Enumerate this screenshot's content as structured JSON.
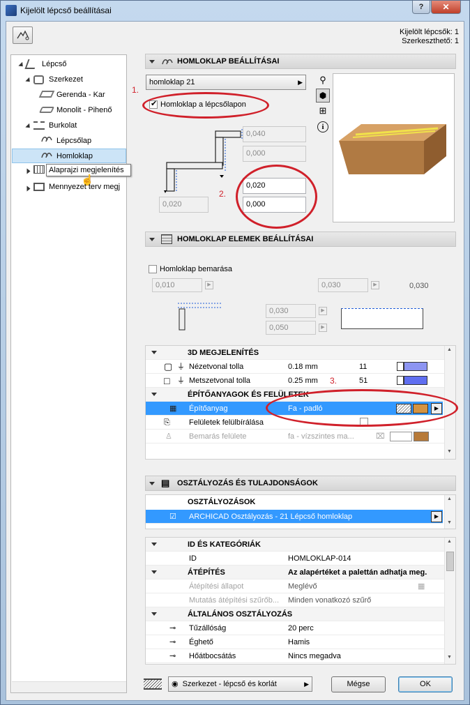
{
  "window": {
    "title": "Kijelölt lépcső beállításai",
    "help": "?"
  },
  "info": {
    "selected": "Kijelölt lépcsők: 1",
    "editable": "Szerkeszthető: 1"
  },
  "tree": {
    "items": [
      {
        "label": "Lépcső"
      },
      {
        "label": "Szerkezet"
      },
      {
        "label": "Gerenda - Kar"
      },
      {
        "label": "Monolit - Pihenő"
      },
      {
        "label": "Burkolat"
      },
      {
        "label": "Lépcsőlap"
      },
      {
        "label": "Homloklap"
      },
      {
        "label": "Alaprajzi megjelenítés"
      },
      {
        "label": "Mennyezet terv megj"
      }
    ]
  },
  "section1": {
    "title": "HOMLOKLAP BEÁLLÍTÁSAI",
    "dropdown": "homloklap 21",
    "checkbox_label": "Homloklap a lépcsőlapon",
    "field1": "0,040",
    "field2": "0,000",
    "field3": "0,020",
    "field4": "0,000",
    "field_left": "0,020"
  },
  "section2": {
    "title": "HOMLOKLAP ELEMEK BEÁLLÍTÁSAI",
    "checkbox_label": "Homloklap bemarása",
    "field_a": "0,010",
    "field_b": "0,030",
    "field_b_text": "0,030",
    "field_c": "0,030",
    "field_d": "0,050"
  },
  "props1": {
    "group1": "3D MEGJELENÍTÉS",
    "row1": {
      "label": "Nézetvonal tolla",
      "value": "0.18 mm",
      "pen": "11"
    },
    "row2": {
      "label": "Metszetvonal tolla",
      "value": "0.25 mm",
      "pen": "51"
    },
    "group2": "ÉPÍTŐANYAGOK ÉS FELÜLETEK",
    "row3": {
      "label": "Építőanyag",
      "value": "Fa - padló"
    },
    "row4": {
      "label": "Felületek felülbírálása"
    },
    "row5": {
      "label": "Bemarás felülete",
      "value": "fa - vízszintes ma..."
    }
  },
  "section3": {
    "title": "OSZTÁLYOZÁS ÉS TULAJDONSÁGOK"
  },
  "classes": {
    "header": "OSZTÁLYOZÁSOK",
    "item": "ARCHICAD Osztályozás - 21 Lépcső homloklap"
  },
  "props2": {
    "g_id": "ID ÉS KATEGÓRIÁK",
    "id_label": "ID",
    "id_value": "HOMLOKLAP-014",
    "g_reno": "ÁTÉPÍTÉS",
    "g_reno_value": "Az alapértéket a palettán adhatja meg.",
    "reno_state": "Átépítési állapot",
    "reno_state_value": "Meglévő",
    "reno_filter": "Mutatás átépítési szűrőb...",
    "reno_filter_value": "Minden vonatkozó szűrő",
    "g_general": "ÁLTALÁNOS OSZTÁLYOZÁS",
    "fire": "Tűzállóság",
    "fire_value": "20 perc",
    "burn": "Éghető",
    "burn_value": "Hamis",
    "heat": "Hőátbocsátás",
    "heat_value": "Nincs megadva"
  },
  "footer": {
    "dropdown": "Szerkezet - lépcső és korlát",
    "cancel": "Mégse",
    "ok": "OK"
  },
  "annotations": {
    "n1": "1.",
    "n2": "2.",
    "n3": "3."
  },
  "colors": {
    "selection": "#3399ff",
    "annotation": "#d0202a",
    "wood": "#c2894e"
  }
}
